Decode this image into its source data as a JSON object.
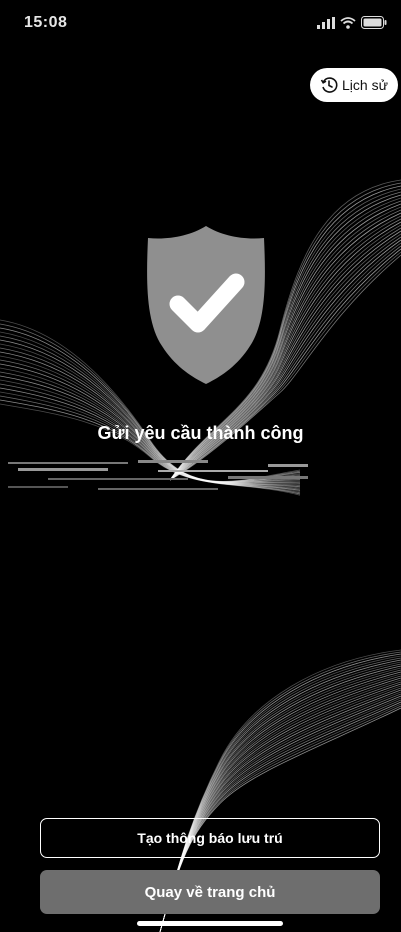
{
  "status_bar": {
    "time": "15:08",
    "icons": [
      "signal-icon",
      "wifi-icon",
      "battery-icon"
    ]
  },
  "header": {
    "history_label": "Lịch sử",
    "history_icon": "history-clock-icon"
  },
  "result": {
    "title": "Gửi yêu cầu thành công",
    "icon": "shield-check-icon"
  },
  "actions": {
    "create_notice_label": "Tạo thông báo lưu trú",
    "go_home_label": "Quay về trang chủ"
  },
  "colors": {
    "background": "#000000",
    "shield": "#8f8f8f",
    "primary_button": "#6e6e6e",
    "text": "#ffffff"
  }
}
